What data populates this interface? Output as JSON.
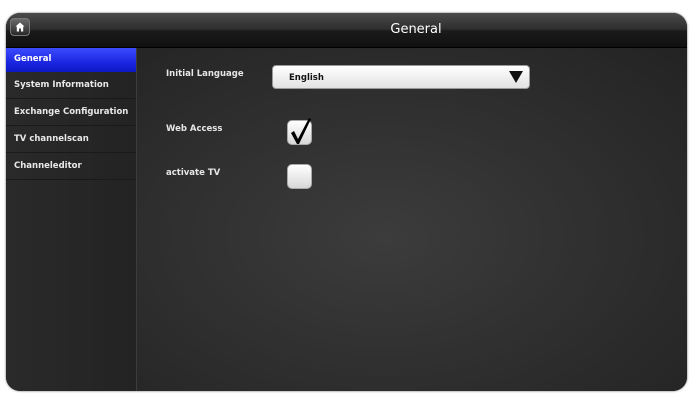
{
  "header": {
    "title": "General",
    "home_icon": "home-icon"
  },
  "sidebar": {
    "items": [
      {
        "label": "General",
        "active": true
      },
      {
        "label": "System Information",
        "active": false
      },
      {
        "label": "Exchange Configuration",
        "active": false
      },
      {
        "label": "TV channelscan",
        "active": false
      },
      {
        "label": "Channeleditor",
        "active": false
      }
    ]
  },
  "settings": {
    "initial_language": {
      "label": "Initial Language",
      "value": "English"
    },
    "web_access": {
      "label": "Web Access",
      "checked": true
    },
    "activate_tv": {
      "label": "activate TV",
      "checked": false
    }
  },
  "colors": {
    "accent": "#1a26e0",
    "background": "#2e2e2e"
  }
}
